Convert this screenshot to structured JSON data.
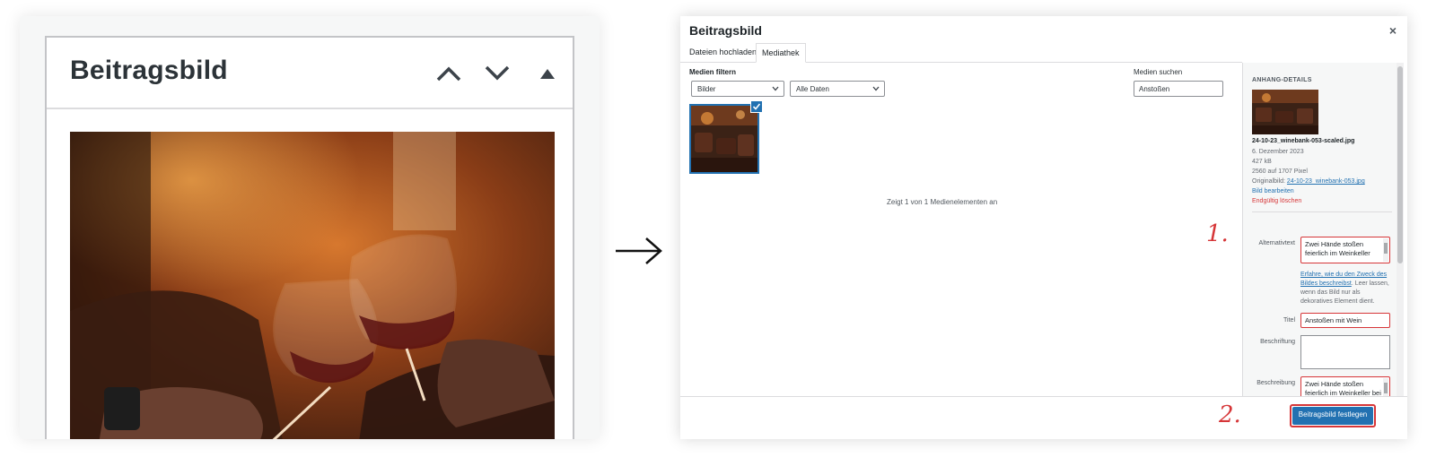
{
  "left": {
    "title": "Beitragsbild",
    "buttons": [
      "move-up",
      "move-down",
      "toggle-panel"
    ]
  },
  "modal": {
    "title": "Beitragsbild",
    "close": "×",
    "tabs": {
      "upload": "Dateien hochladen",
      "library": "Mediathek"
    },
    "filter": {
      "label": "Medien filtern",
      "type_selected": "Bilder",
      "date_selected": "Alle Daten"
    },
    "search": {
      "label": "Medien suchen",
      "value": "Anstoßen"
    },
    "count_text": "Zeigt 1 von 1 Medienelementen an",
    "sidebar": {
      "heading": "ANHANG-DETAILS",
      "filename": "24-10-23_winebank-053-scaled.jpg",
      "date": "6. Dezember 2023",
      "filesize": "427 kB",
      "dimensions": "2560 auf 1707 Pixel",
      "original_label": "Originalbild:",
      "original_link": "24-10-23_winebank-053.jpg",
      "edit_link": "Bild bearbeiten",
      "delete_link": "Endgültig löschen",
      "alt_label": "Alternativtext",
      "alt_value": "Zwei Hände stoßen feierlich im Weinkeller",
      "alt_help_link": "Erfahre, wie du den Zweck des Bildes beschreibst",
      "alt_help_text": ". Leer lassen, wenn das Bild nur als dekoratives Element dient.",
      "title_label": "Titel",
      "title_value": "Anstoßen mit Wein",
      "caption_label": "Beschriftung",
      "caption_value": "",
      "description_label": "Beschreibung",
      "description_value": "Zwei Hände stoßen feierlich im Weinkeller bei gedimmten Licht"
    },
    "primary_button": "Beitragsbild festlegen"
  },
  "annotations": {
    "step1": "1.",
    "step2": "2."
  },
  "colors": {
    "accent": "#2271b1",
    "highlight": "#d63638"
  }
}
